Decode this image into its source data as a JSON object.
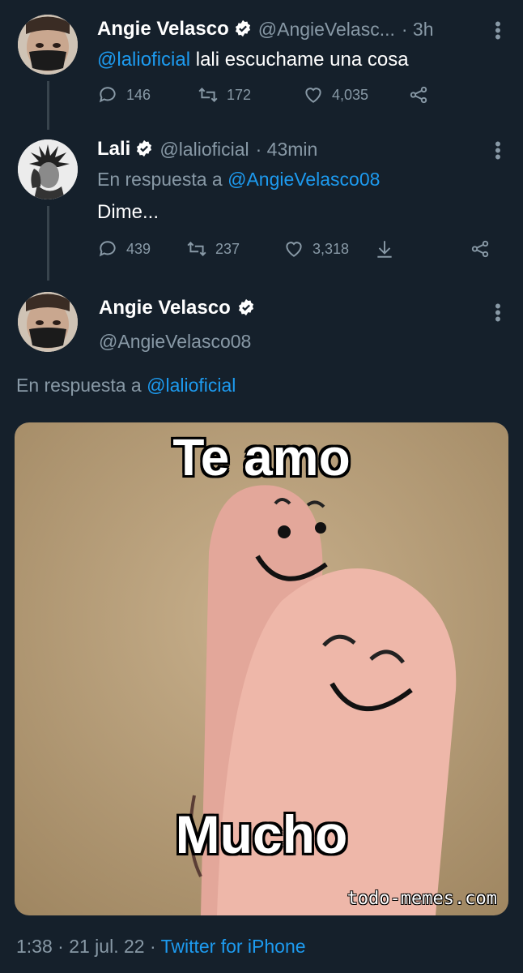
{
  "colors": {
    "background": "#15202b",
    "link": "#1d9bf0",
    "muted": "#8899a6",
    "text": "#ffffff"
  },
  "tweet1": {
    "name": "Angie Velasco",
    "handle": "@AngieVelasc...",
    "time": "· 3h",
    "mention": "@lalioficial",
    "text": " lali escuchame una cosa",
    "replies": "146",
    "retweets": "172",
    "likes": "4,035"
  },
  "tweet2": {
    "name": "Lali",
    "handle": "@lalioficial",
    "time": "· 43min",
    "reply_prefix": "En respuesta a ",
    "reply_to": "@AngieVelasco08",
    "text": "Dime...",
    "replies": "439",
    "retweets": "237",
    "likes": "3,318"
  },
  "main_tweet": {
    "name": "Angie Velasco",
    "handle": "@AngieVelasco08",
    "reply_prefix": "En respuesta a ",
    "reply_to": "@lalioficial",
    "image": {
      "text_top": "Te amo",
      "text_bottom": "Mucho",
      "watermark": "todo-memes.com"
    },
    "timestamp": "1:38 · 21 jul. 22 · ",
    "source": "Twitter for iPhone"
  },
  "icons": [
    "verified-icon",
    "more-icon",
    "reply-icon",
    "retweet-icon",
    "like-icon",
    "share-icon",
    "download-icon"
  ]
}
